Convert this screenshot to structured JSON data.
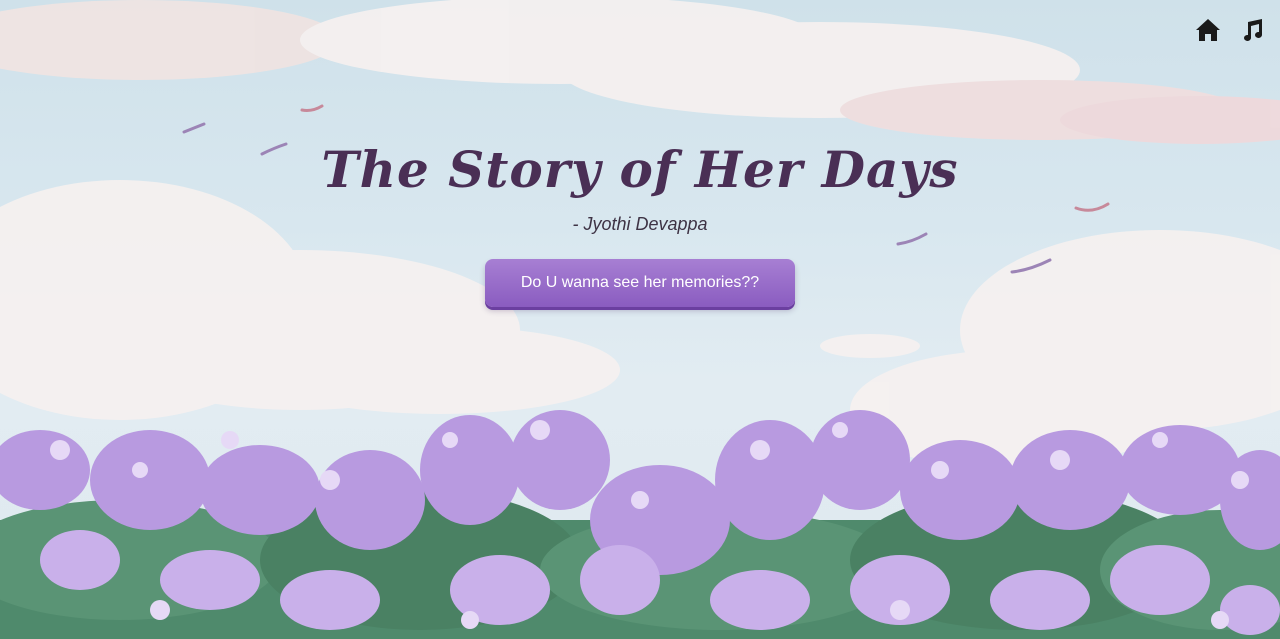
{
  "header": {
    "home_icon": "home-icon",
    "music_icon": "music-note-icon"
  },
  "hero": {
    "title": "The Story of Her Days",
    "author": "- Jyothi Devappa",
    "cta_label": "Do U wanna see her memories??"
  },
  "colors": {
    "sky": "#d8e7ef",
    "title": "#4a2f55",
    "button": "#9a6dcb",
    "flower": "#b89ae0",
    "leaf": "#4f8a6c"
  }
}
